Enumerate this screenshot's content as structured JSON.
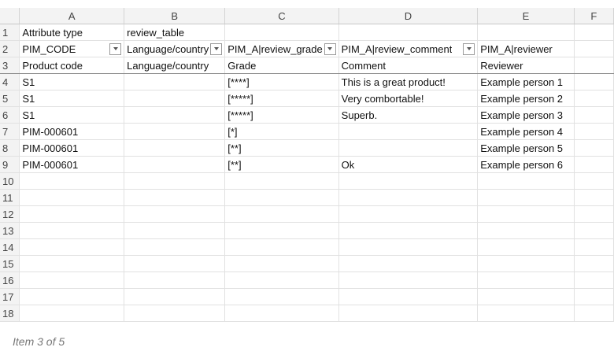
{
  "columns": [
    "A",
    "B",
    "C",
    "D",
    "E",
    "F"
  ],
  "rows": [
    {
      "num": "1",
      "cells": [
        "Attribute type",
        "review_table",
        "",
        "",
        "",
        ""
      ]
    },
    {
      "num": "2",
      "cells": [
        "PIM_CODE",
        "Language/country",
        "PIM_A|review_grade",
        "PIM_A|review_comment",
        "PIM_A|reviewer",
        ""
      ]
    },
    {
      "num": "3",
      "cells": [
        "Product code",
        "Language/country",
        "Grade",
        "Comment",
        "Reviewer",
        ""
      ]
    },
    {
      "num": "4",
      "cells": [
        "S1",
        "",
        "[****]",
        "This is a great product!",
        "Example person 1",
        ""
      ]
    },
    {
      "num": "5",
      "cells": [
        "S1",
        "",
        "[*****]",
        "Very combortable!",
        "Example person 2",
        ""
      ]
    },
    {
      "num": "6",
      "cells": [
        "S1",
        "",
        "[*****]",
        "Superb.",
        "Example person 3",
        ""
      ]
    },
    {
      "num": "7",
      "cells": [
        "PIM-000601",
        "",
        "[*]",
        "",
        "Example person 4",
        ""
      ]
    },
    {
      "num": "8",
      "cells": [
        "PIM-000601",
        "",
        "[**]",
        "",
        "Example person 5",
        ""
      ]
    },
    {
      "num": "9",
      "cells": [
        "PIM-000601",
        "",
        "[**]",
        "Ok",
        "Example person 6",
        ""
      ]
    },
    {
      "num": "10",
      "cells": [
        "",
        "",
        "",
        "",
        "",
        ""
      ]
    },
    {
      "num": "11",
      "cells": [
        "",
        "",
        "",
        "",
        "",
        ""
      ]
    },
    {
      "num": "12",
      "cells": [
        "",
        "",
        "",
        "",
        "",
        ""
      ]
    },
    {
      "num": "13",
      "cells": [
        "",
        "",
        "",
        "",
        "",
        ""
      ]
    },
    {
      "num": "14",
      "cells": [
        "",
        "",
        "",
        "",
        "",
        ""
      ]
    },
    {
      "num": "15",
      "cells": [
        "",
        "",
        "",
        "",
        "",
        ""
      ]
    },
    {
      "num": "16",
      "cells": [
        "",
        "",
        "",
        "",
        "",
        ""
      ]
    },
    {
      "num": "17",
      "cells": [
        "",
        "",
        "",
        "",
        "",
        ""
      ]
    },
    {
      "num": "18",
      "cells": [
        "",
        "",
        "",
        "",
        "",
        ""
      ]
    }
  ],
  "filter_row": "2",
  "filter_columns": [
    "A",
    "B",
    "C",
    "D"
  ],
  "caption": "Item 3 of 5",
  "colors": {
    "header_bg": "#f3f3f3",
    "gridline": "#e1e1e1"
  }
}
